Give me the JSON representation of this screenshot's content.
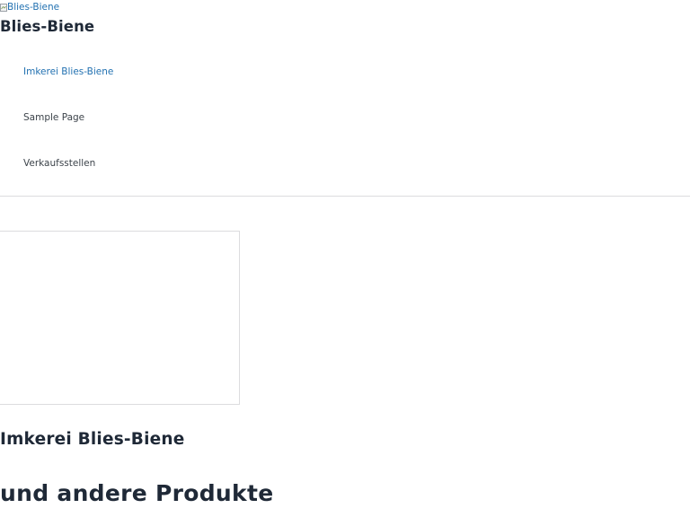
{
  "header": {
    "logo_alt": "Blies-Biene",
    "site_title": "Blies-Biene"
  },
  "nav": {
    "items": [
      {
        "label": "Imkerei Blies-Biene",
        "current": true
      },
      {
        "label": "Sample Page",
        "current": false
      },
      {
        "label": "Verkaufsstellen",
        "current": false
      }
    ]
  },
  "main": {
    "post_title": "Imkerei Blies-Biene",
    "heading": "und andere Produkte"
  },
  "colors": {
    "link": "#2271b1",
    "text": "#1f2937",
    "divider": "#dcdcde"
  }
}
